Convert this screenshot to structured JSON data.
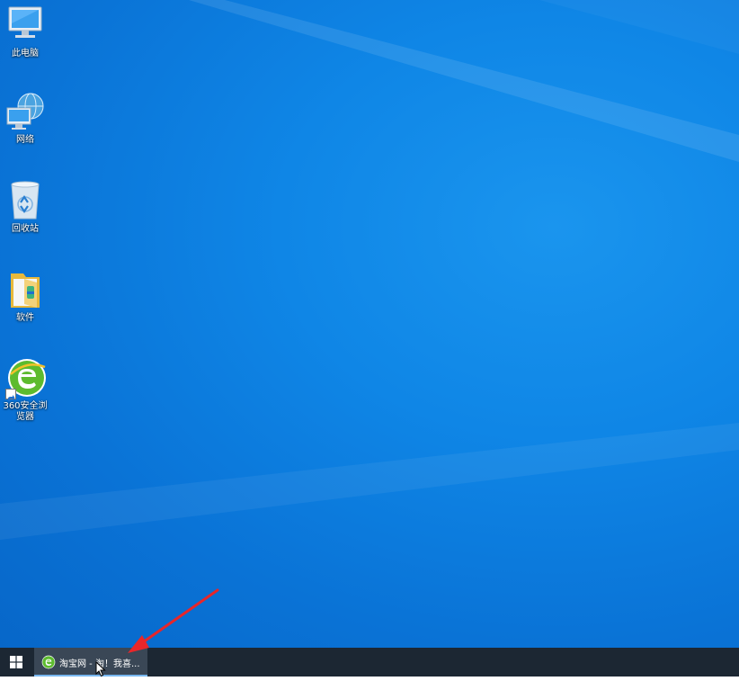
{
  "desktop": {
    "icons": [
      {
        "name": "this-pc",
        "label": "此电脑",
        "icon": "computer-icon"
      },
      {
        "name": "network",
        "label": "网络",
        "icon": "network-globe-icon"
      },
      {
        "name": "recycle-bin",
        "label": "回收站",
        "icon": "recycle-bin-icon"
      },
      {
        "name": "software-folder",
        "label": "软件",
        "icon": "folder-icon"
      },
      {
        "name": "360-browser",
        "label": "360安全浏览器",
        "icon": "360-browser-icon"
      }
    ]
  },
  "taskbar": {
    "start_icon": "windows-logo-icon",
    "open_window": {
      "label": "淘宝网 - 淘！我喜...",
      "icon": "360-browser-icon",
      "active": true
    }
  },
  "annotation": {
    "type": "red-arrow",
    "color": "#e8262a",
    "points_to": "taskbar-window-button"
  },
  "colors": {
    "desktop_bg": "#0f86e6",
    "taskbar_bg": "#1c2733",
    "taskbar_item_bg": "#3a4756",
    "active_underline": "#78b7f0"
  }
}
